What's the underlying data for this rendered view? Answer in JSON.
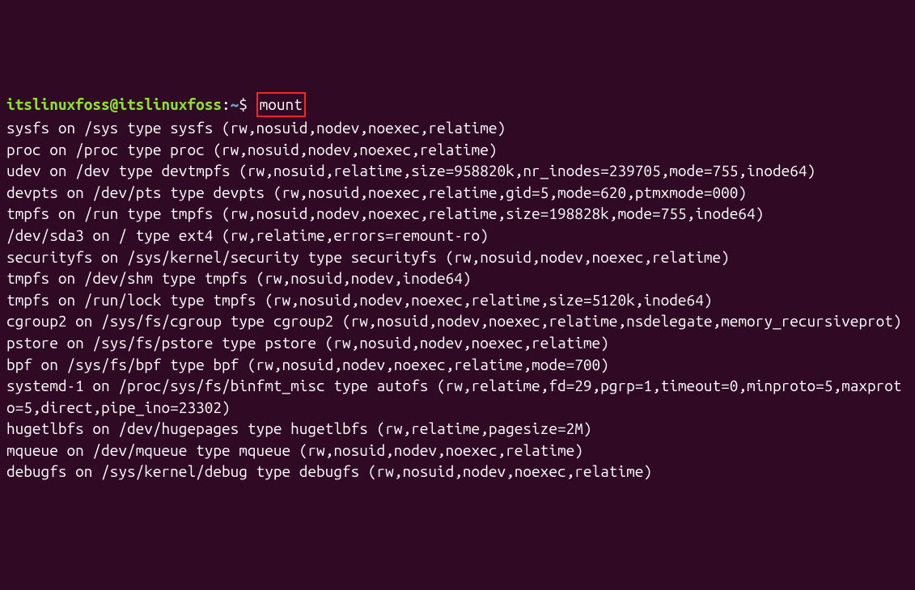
{
  "prompt": {
    "user_host": "itslinuxfoss@itslinuxfoss",
    "separator": ":",
    "path": "~",
    "dollar": "$ "
  },
  "command": "mount",
  "output_lines": [
    "sysfs on /sys type sysfs (rw,nosuid,nodev,noexec,relatime)",
    "proc on /proc type proc (rw,nosuid,nodev,noexec,relatime)",
    "udev on /dev type devtmpfs (rw,nosuid,relatime,size=958820k,nr_inodes=239705,mode=755,inode64)",
    "devpts on /dev/pts type devpts (rw,nosuid,noexec,relatime,gid=5,mode=620,ptmxmode=000)",
    "tmpfs on /run type tmpfs (rw,nosuid,nodev,noexec,relatime,size=198828k,mode=755,inode64)",
    "/dev/sda3 on / type ext4 (rw,relatime,errors=remount-ro)",
    "securityfs on /sys/kernel/security type securityfs (rw,nosuid,nodev,noexec,relatime)",
    "tmpfs on /dev/shm type tmpfs (rw,nosuid,nodev,inode64)",
    "tmpfs on /run/lock type tmpfs (rw,nosuid,nodev,noexec,relatime,size=5120k,inode64)",
    "cgroup2 on /sys/fs/cgroup type cgroup2 (rw,nosuid,nodev,noexec,relatime,nsdelegate,memory_recursiveprot)",
    "pstore on /sys/fs/pstore type pstore (rw,nosuid,nodev,noexec,relatime)",
    "bpf on /sys/fs/bpf type bpf (rw,nosuid,nodev,noexec,relatime,mode=700)",
    "systemd-1 on /proc/sys/fs/binfmt_misc type autofs (rw,relatime,fd=29,pgrp=1,timeout=0,minproto=5,maxproto=5,direct,pipe_ino=23302)",
    "hugetlbfs on /dev/hugepages type hugetlbfs (rw,relatime,pagesize=2M)",
    "mqueue on /dev/mqueue type mqueue (rw,nosuid,nodev,noexec,relatime)",
    "debugfs on /sys/kernel/debug type debugfs (rw,nosuid,nodev,noexec,relatime)"
  ]
}
